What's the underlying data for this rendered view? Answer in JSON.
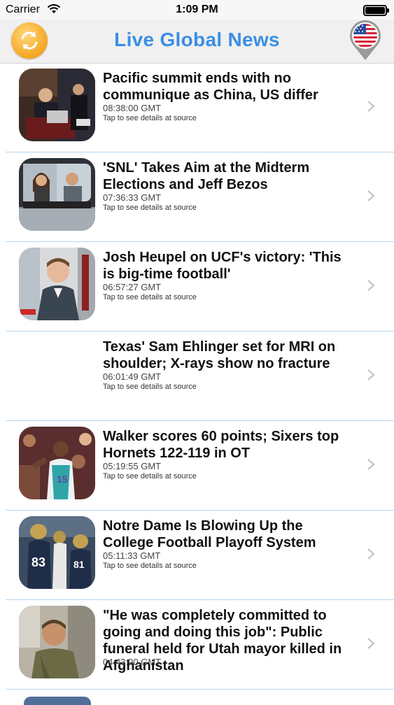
{
  "status_bar": {
    "carrier": "Carrier",
    "time": "1:09 PM"
  },
  "nav": {
    "title": "Live Global News",
    "refresh_icon": "refresh-icon",
    "flag_icon": "us-flag-pin-icon",
    "title_color": "#3a8ee6"
  },
  "articles": [
    {
      "headline": "Pacific summit ends with no communique as China, US differ",
      "time": "08:38:00 GMT",
      "note": "Tap to see details at source",
      "thumbnail": "summit-photo"
    },
    {
      "headline": "'SNL' Takes Aim at the Midterm Elections and Jeff Bezos",
      "time": "07:36:33 GMT",
      "note": "Tap to see details at source",
      "thumbnail": "car-scene-photo"
    },
    {
      "headline": "Josh Heupel on UCF's victory: 'This is big-time football'",
      "time": "06:57:27 GMT",
      "note": "Tap to see details at source",
      "thumbnail": "coach-photo"
    },
    {
      "headline": "Texas' Sam Ehlinger set for MRI on shoulder; X-rays show no fracture",
      "time": "06:01:49 GMT",
      "note": "Tap to see details at source",
      "thumbnail": ""
    },
    {
      "headline": "Walker scores 60 points; Sixers top Hornets 122-119 in OT",
      "time": "05:19:55 GMT",
      "note": "Tap to see details at source",
      "thumbnail": "basketball-photo"
    },
    {
      "headline": "Notre Dame Is Blowing Up the College Football Playoff System",
      "time": "05:11:33 GMT",
      "note": "Tap to see details at source",
      "thumbnail": "football-team-photo"
    },
    {
      "headline": "\"He was completely committed to going and doing this job\": Public funeral held for Utah mayor killed in Afghanistan",
      "time": "04:43:00 GMT",
      "note": "",
      "thumbnail": "soldier-photo"
    }
  ]
}
